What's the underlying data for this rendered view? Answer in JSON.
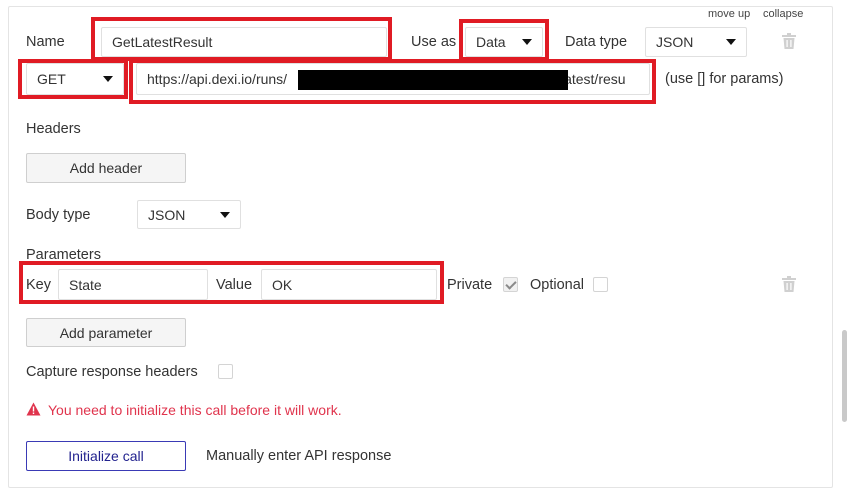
{
  "top_links": {
    "move_up": "move up",
    "collapse": "collapse"
  },
  "name_row": {
    "name_label": "Name",
    "name_value": "GetLatestResult",
    "use_as_label": "Use as",
    "use_as_value": "Data",
    "data_type_label": "Data type",
    "data_type_value": "JSON"
  },
  "url_row": {
    "method": "GET",
    "url_prefix": "https://api.dexi.io/runs/",
    "url_suffix": "/latest/resu",
    "params_hint": "(use [] for params)"
  },
  "headers": {
    "label": "Headers",
    "add_button": "Add header"
  },
  "body_type": {
    "label": "Body type",
    "value": "JSON"
  },
  "parameters": {
    "label": "Parameters",
    "key_label": "Key",
    "key_value": "State",
    "value_label": "Value",
    "value_value": "OK",
    "private_label": "Private",
    "private_checked": true,
    "optional_label": "Optional",
    "optional_checked": false,
    "add_button": "Add parameter"
  },
  "capture": {
    "label": "Capture response headers",
    "checked": false
  },
  "warning": {
    "text": "You need to initialize this call before it will work."
  },
  "actions": {
    "initialize": "Initialize call",
    "manual": "Manually enter API response"
  },
  "colors": {
    "highlight": "#e01b24",
    "warning": "#e0344d",
    "primary": "#3a3ab5"
  },
  "icons": {
    "delete": "trash-icon",
    "warning": "warning-triangle-icon",
    "dropdown": "caret-down-icon",
    "check": "check-icon"
  }
}
